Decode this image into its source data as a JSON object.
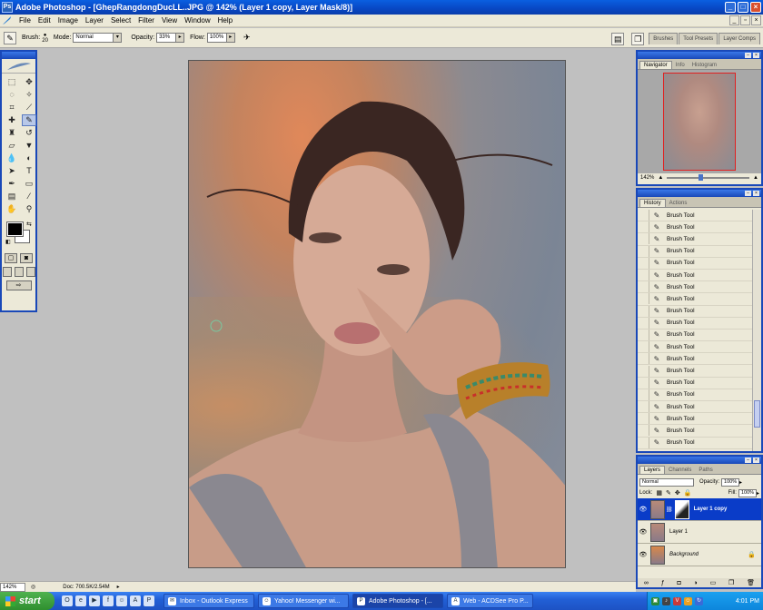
{
  "window": {
    "app_icon": "Ps",
    "title": "Adobe Photoshop - [GhepRangdongDucLL..JPG @ 142% (Layer 1 copy, Layer Mask/8)]"
  },
  "menu": [
    "File",
    "Edit",
    "Image",
    "Layer",
    "Select",
    "Filter",
    "View",
    "Window",
    "Help"
  ],
  "options": {
    "brush_label": "Brush:",
    "brush_size": "20",
    "mode_label": "Mode:",
    "mode_value": "Normal",
    "opacity_label": "Opacity:",
    "opacity_value": "33%",
    "flow_label": "Flow:",
    "flow_value": "100%"
  },
  "palette_well": [
    "Brushes",
    "Tool Presets",
    "Layer Comps"
  ],
  "navigator": {
    "tabs": [
      "Navigator",
      "Info",
      "Histogram"
    ],
    "zoom": "142%"
  },
  "history": {
    "tabs": [
      "History",
      "Actions"
    ],
    "items": [
      "Brush Tool",
      "Brush Tool",
      "Brush Tool",
      "Brush Tool",
      "Brush Tool",
      "Brush Tool",
      "Brush Tool",
      "Brush Tool",
      "Brush Tool",
      "Brush Tool",
      "Brush Tool",
      "Brush Tool",
      "Brush Tool",
      "Brush Tool",
      "Brush Tool",
      "Brush Tool",
      "Brush Tool",
      "Brush Tool",
      "Brush Tool",
      "Brush Tool"
    ]
  },
  "layers": {
    "tabs": [
      "Layers",
      "Channels",
      "Paths"
    ],
    "blend": "Normal",
    "opacity_label": "Opacity:",
    "opacity_value": "100%",
    "lock_label": "Lock:",
    "fill_label": "Fill:",
    "fill_value": "100%",
    "items": [
      {
        "name": "Layer 1 copy",
        "selected": true
      },
      {
        "name": "Layer 1",
        "selected": false
      },
      {
        "name": "Background",
        "selected": false
      }
    ]
  },
  "status": {
    "zoom": "142%",
    "doc": "Doc: 700.5K/2.54M"
  },
  "taskbar": {
    "start": "start",
    "tasks": [
      {
        "label": "Inbox - Outlook Express",
        "active": false
      },
      {
        "label": "Yahoo! Messenger wi...",
        "active": false
      },
      {
        "label": "Adobe Photoshop - [...",
        "active": true
      },
      {
        "label": "Web - ACDSee Pro P...",
        "active": false
      }
    ],
    "clock": "4:01 PM"
  }
}
